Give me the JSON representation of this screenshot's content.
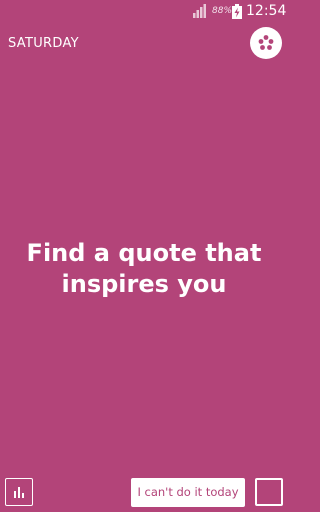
{
  "status_bar": {
    "battery_percent": "88%",
    "time": "12:54",
    "icons": [
      "signal-icon",
      "battery-charging-icon"
    ]
  },
  "header": {
    "day": "SATURDAY",
    "menu_icon": "dots-menu-icon"
  },
  "main": {
    "quote": "Find a quote that inspires you"
  },
  "footer": {
    "stats_icon": "bar-chart-icon",
    "cant_do_label": "I can't do it today",
    "done_checkbox_icon": "empty-checkbox-icon"
  },
  "colors": {
    "background": "#b34479",
    "foreground": "#ffffff"
  }
}
